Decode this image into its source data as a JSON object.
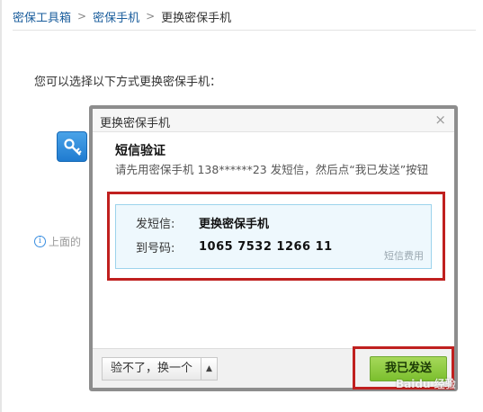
{
  "breadcrumb": {
    "items": [
      "密保工具箱",
      "密保手机",
      "更换密保手机"
    ],
    "separator": ">"
  },
  "intro": "您可以选择以下方式更换密保手机：",
  "background": {
    "option_icon": "key-icon",
    "info_text": "上面的"
  },
  "modal": {
    "title": "更换密保手机",
    "close": "×",
    "sms_title": "短信验证",
    "sms_description": "请先用密保手机 138******23 发短信，然后点“我已发送”按钮",
    "sms_box": {
      "content_label": "发短信:",
      "content_value": "更换密保手机",
      "number_label": "到号码:",
      "number_value": "1065 7532 1266 11",
      "fee_link": "短信费用"
    },
    "footer": {
      "switch_label": "验不了，换一个",
      "switch_arrow": "▲",
      "sent_button": "我已发送"
    }
  },
  "watermark": "Baidu 经验",
  "colors": {
    "link": "#1a5d9c",
    "highlight_box": "#c0201f",
    "sms_box_bg": "#eef8fd",
    "sent_button": "#8fcb45"
  }
}
